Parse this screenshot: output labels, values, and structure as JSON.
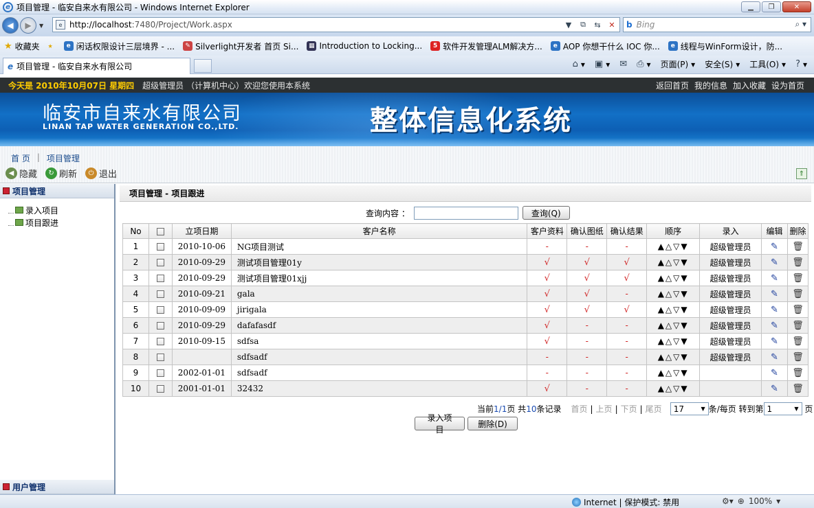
{
  "window": {
    "title": "项目管理 - 临安自来水有限公司 - Windows Internet Explorer",
    "url_host": "http://localhost",
    "url_rest": ":7480/Project/Work.aspx",
    "search_placeholder": "Bing"
  },
  "favorites": {
    "label": "收藏夹",
    "items": [
      "闲话权限设计三层境界 - ...",
      "Silverlight开发者  首页 Si...",
      "Introduction to Locking...",
      "软件开发管理ALM解决方...",
      "AOP 你想干什么 IOC 你...",
      "线程与WinForm设计，防..."
    ]
  },
  "tab": {
    "title": "项目管理 - 临安自来水有限公司"
  },
  "commands": [
    "页面(P)",
    "安全(S)",
    "工具(O)"
  ],
  "top": {
    "today": "今天是 2010年10月07日 星期四",
    "user": "超级管理员 （计算机中心）欢迎您使用本系统",
    "links": [
      "返回首页",
      "我的信息",
      "加入收藏",
      "设为首页"
    ]
  },
  "banner": {
    "company_cn": "临安市自来水有限公司",
    "company_en": "LINAN TAP WATER GENERATION CO.,LTD.",
    "system": "整体信息化系统"
  },
  "breadcrumb": {
    "home": "首 页",
    "current": "项目管理"
  },
  "toolbar": {
    "hide": "隐藏",
    "refresh": "刷新",
    "logout": "退出"
  },
  "sidebar": {
    "section": "项目管理",
    "items": [
      "录入项目",
      "项目跟进"
    ],
    "footer": "用户管理"
  },
  "main": {
    "title": "项目管理 - 项目跟进",
    "query_label": "查询内容 ：",
    "query_button": "查询(Q)",
    "columns": [
      "No",
      "",
      "立项日期",
      "客户名称",
      "客户资料",
      "确认图纸",
      "确认结果",
      "顺序",
      "录入",
      "编辑",
      "删除"
    ],
    "rows": [
      {
        "no": "1",
        "date": "2010-10-06",
        "name": "NG项目测试",
        "c1": "-",
        "c2": "-",
        "c3": "-",
        "order": "▲△▽▼",
        "by": "超级管理员"
      },
      {
        "no": "2",
        "date": "2010-09-29",
        "name": "测试项目管理01y",
        "c1": "√",
        "c2": "√",
        "c3": "√",
        "order": "▲△▽▼",
        "by": "超级管理员"
      },
      {
        "no": "3",
        "date": "2010-09-29",
        "name": "测试项目管理01xjj",
        "c1": "√",
        "c2": "√",
        "c3": "√",
        "order": "▲△▽▼",
        "by": "超级管理员"
      },
      {
        "no": "4",
        "date": "2010-09-21",
        "name": "gala",
        "c1": "√",
        "c2": "√",
        "c3": "-",
        "order": "▲△▽▼",
        "by": "超级管理员"
      },
      {
        "no": "5",
        "date": "2010-09-09",
        "name": "jirigala",
        "c1": "√",
        "c2": "√",
        "c3": "√",
        "order": "▲△▽▼",
        "by": "超级管理员"
      },
      {
        "no": "6",
        "date": "2010-09-29",
        "name": "dafafasdf",
        "c1": "√",
        "c2": "-",
        "c3": "-",
        "order": "▲△▽▼",
        "by": "超级管理员"
      },
      {
        "no": "7",
        "date": "2010-09-15",
        "name": "sdfsa",
        "c1": "√",
        "c2": "-",
        "c3": "-",
        "order": "▲△▽▼",
        "by": "超级管理员"
      },
      {
        "no": "8",
        "date": "",
        "name": "sdfsadf",
        "c1": "-",
        "c2": "-",
        "c3": "-",
        "order": "▲△▽▼",
        "by": "超级管理员"
      },
      {
        "no": "9",
        "date": "2002-01-01",
        "name": "sdfsadf",
        "c1": "-",
        "c2": "-",
        "c3": "-",
        "order": "▲△▽▼",
        "by": ""
      },
      {
        "no": "10",
        "date": "2001-01-01",
        "name": "32432",
        "c1": "√",
        "c2": "-",
        "c3": "-",
        "order": "▲△▽▼",
        "by": ""
      }
    ],
    "pager": {
      "prefix": "当前",
      "current": "1/1",
      "page_word": "页",
      "total_prefix": "共",
      "total": "10",
      "total_suffix": "条记录",
      "first": "首页",
      "prev": "上页",
      "next": "下页",
      "last": "尾页",
      "page_size": "17",
      "per_page": "条/每页 转到第",
      "goto": "1",
      "goto_suffix": "页"
    },
    "add_button": "录入项目",
    "delete_button": "删除(D)"
  },
  "status": {
    "zone": "Internet | 保护模式: 禁用",
    "zoom": "100%"
  }
}
